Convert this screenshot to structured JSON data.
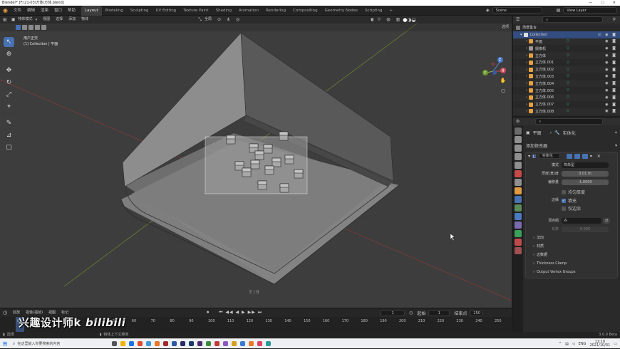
{
  "titlebar": {
    "text": "Blender* [F:\\21-03\\万体\\万体.blend]",
    "controls": [
      "—",
      "□",
      "✕"
    ]
  },
  "topmenu": [
    "文件",
    "编辑",
    "渲染",
    "窗口",
    "帮助"
  ],
  "workspaces": [
    "Layout",
    "Modeling",
    "Sculpting",
    "UV Editing",
    "Texture Paint",
    "Shading",
    "Animation",
    "Rendering",
    "Compositing",
    "Geometry Nodes",
    "Scripting",
    "+"
  ],
  "scene": {
    "label": "Scene",
    "view_layer": "View Layer"
  },
  "viewport": {
    "mode": "物体模式",
    "menus": [
      "视图",
      "选择",
      "添加",
      "物体"
    ],
    "orientation": "全局",
    "options_label": "选项",
    "info_line1": "用户正交",
    "info_line2": "(1) Collection | 平面",
    "gizmo_axes": {
      "z": "Z",
      "y": "Y",
      "x": "X"
    },
    "extrude_label": "E / B"
  },
  "outliner": {
    "header": "场景集合",
    "collection": "Collection",
    "items": [
      "平面",
      "摄像机",
      "立方体",
      "立方体.001",
      "立方体.002",
      "立方体.003",
      "立方体.004",
      "立方体.005",
      "立方体.006",
      "立方体.007",
      "立方体.008"
    ]
  },
  "properties": {
    "object_name": "平面",
    "modifier_tab_label": "实体化",
    "add_modifier": "添加修改器",
    "modifier_name": "实体化",
    "mode_label": "模式",
    "mode_value": "简单型",
    "thickness_label": "厚度(宽)度",
    "thickness_value": "0.01 m",
    "offset_label": "偏移量",
    "offset_value": "-1.0000",
    "even_label": "均匀厚度",
    "rim_label": "边缘",
    "rim_fill": "填充",
    "rim_only": "仅边沿",
    "vgroup_label": "顶点组",
    "factor_label": "系数",
    "factor_value": "0.000",
    "sections": [
      "法向",
      "材质",
      "边数据",
      "Thickness Clamp",
      "Output Vertex Groups"
    ]
  },
  "timeline": {
    "menus": [
      "回放",
      "抠像(插帧)",
      "视图",
      "标记"
    ],
    "current_frame": "1",
    "start_label": "起始",
    "start": "1",
    "end_label": "结束点",
    "end": "250",
    "ticks": [
      "0",
      "10",
      "20",
      "30",
      "40",
      "50",
      "60",
      "70",
      "80",
      "90",
      "100",
      "110",
      "120",
      "130",
      "140",
      "150",
      "160",
      "170",
      "180",
      "190",
      "200",
      "210",
      "220",
      "230",
      "240",
      "250"
    ]
  },
  "status": {
    "left": "选择",
    "center": "物体上下文菜单",
    "version": "3.0.0 Beta"
  },
  "taskbar": {
    "search_placeholder": "在这里输入你要搜索的内容",
    "time": "12:10",
    "date": "2021/10/31",
    "lang": "ENG"
  },
  "watermark": {
    "text": "兴趣设计师k",
    "logo": "bilibili"
  },
  "colors": {
    "accent": "#4772b3",
    "selected": "#334d80",
    "active_tab": "#3d3d3d"
  }
}
